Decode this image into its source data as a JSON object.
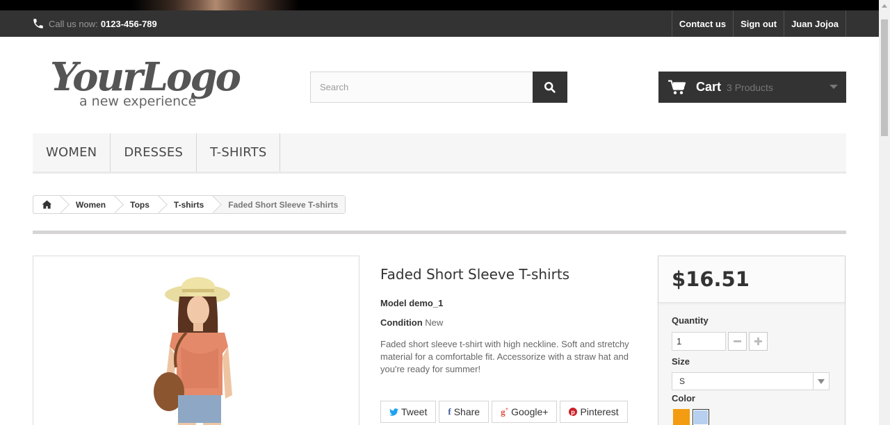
{
  "topbar": {
    "call_label": "Call us now:",
    "phone": "0123-456-789",
    "links": [
      "Contact us",
      "Sign out",
      "Juan Jojoa"
    ]
  },
  "logo": {
    "main": "YourLogo",
    "tagline": "a new experience"
  },
  "search": {
    "placeholder": "Search",
    "icon": "search-icon"
  },
  "cart": {
    "title": "Cart",
    "count": "3 Products"
  },
  "menu": [
    "Women",
    "Dresses",
    "T-shirts"
  ],
  "breadcrumb": [
    "Women",
    "Tops",
    "T-shirts",
    "Faded Short Sleeve T-shirts"
  ],
  "product": {
    "title": "Faded Short Sleeve T-shirts",
    "model_label": "Model",
    "model": "demo_1",
    "condition_label": "Condition",
    "condition": "New",
    "description": "Faded short sleeve t-shirt with high neckline. Soft and stretchy material for a comfortable fit. Accessorize with a straw hat and you're ready for summer!",
    "social": [
      "Tweet",
      "Share",
      "Google+",
      "Pinterest"
    ]
  },
  "buybox": {
    "price": "$16.51",
    "quantity_label": "Quantity",
    "quantity": "1",
    "size_label": "Size",
    "size": "S",
    "color_label": "Color",
    "colors": [
      "#f39c11",
      "#b8d0ef"
    ]
  }
}
